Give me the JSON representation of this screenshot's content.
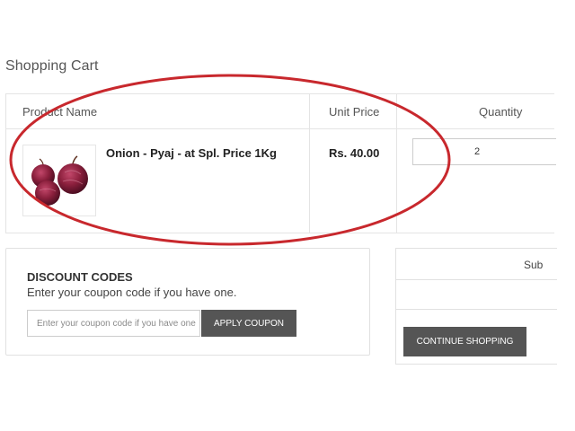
{
  "page": {
    "title": "Shopping Cart"
  },
  "cart": {
    "headers": {
      "product_name": "Product Name",
      "unit_price": "Unit Price",
      "quantity": "Quantity"
    },
    "items": [
      {
        "name": "Onion - Pyaj - at Spl. Price 1Kg",
        "unit_price": "Rs. 40.00",
        "quantity": "2"
      }
    ]
  },
  "discount": {
    "title": "DISCOUNT CODES",
    "subtitle": "Enter your coupon code if you have one.",
    "placeholder": "Enter your coupon code if you have one",
    "apply_label": "APPLY COUPON"
  },
  "totals": {
    "subtotal_label": "Sub",
    "continue_label": "CONTINUE SHOPPING"
  },
  "colors": {
    "annotation": "#c8282d",
    "button": "#555555",
    "onion": "#8a1f3c"
  }
}
